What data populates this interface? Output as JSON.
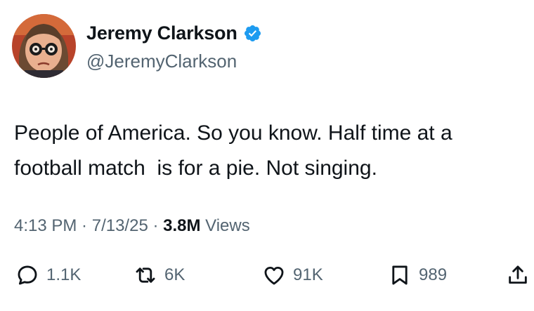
{
  "author": {
    "display_name": "Jeremy Clarkson",
    "handle": "@JeremyClarkson",
    "verified_icon": "verified-badge-icon",
    "badge_color": "#1d9bf0"
  },
  "tweet": {
    "text": "People of America. So you know. Half time at a\nfootball match  is for a pie. Not singing.",
    "time": "4:13 PM",
    "date": "7/13/25",
    "sep": " · ",
    "views_count": "3.8M",
    "views_label": " Views"
  },
  "actions": {
    "replies": "1.1K",
    "reposts": "6K",
    "likes": "91K",
    "bookmarks": "989"
  }
}
